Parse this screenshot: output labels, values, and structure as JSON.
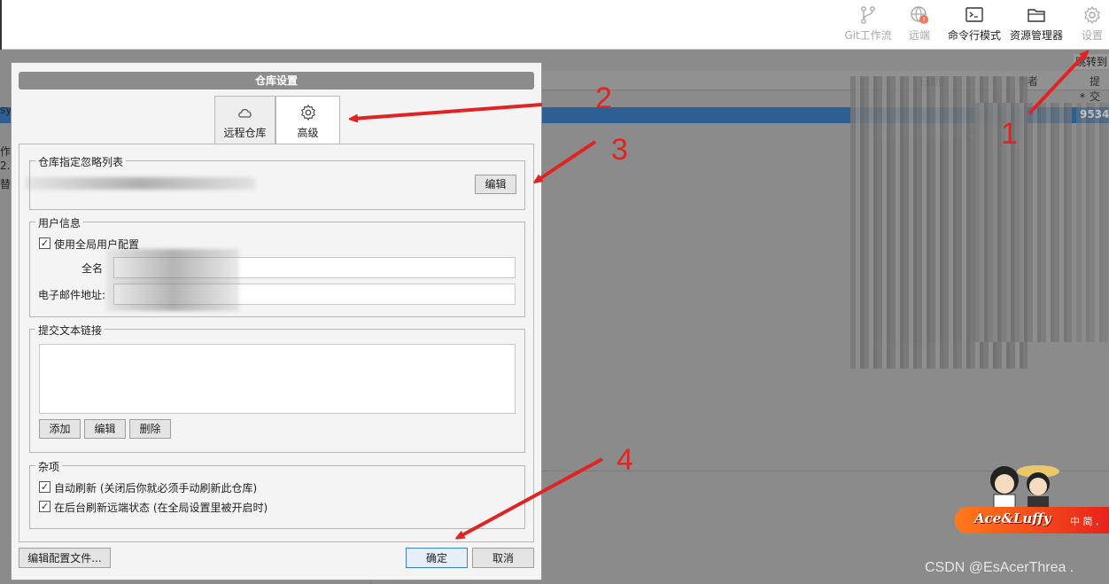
{
  "toolbar": {
    "items": [
      {
        "label": "Git工作流",
        "icon": "git-flow-icon",
        "enabled": false
      },
      {
        "label": "远端",
        "icon": "remote-globe-icon",
        "enabled": false
      },
      {
        "label": "命令行模式",
        "icon": "terminal-icon",
        "enabled": true
      },
      {
        "label": "资源管理器",
        "icon": "folder-icon",
        "enabled": true
      },
      {
        "label": "设置",
        "icon": "gear-icon",
        "enabled": false
      }
    ]
  },
  "background": {
    "jump_label": "跳转到",
    "columns": [
      "日期",
      "作者",
      "提交"
    ],
    "star": "*",
    "hash": "9534",
    "left_cut": [
      "sy",
      "作",
      "2.",
      "替换"
    ]
  },
  "dialog": {
    "title": "仓库设置",
    "tabs": [
      {
        "label": "远程仓库",
        "icon": "cloud-icon",
        "active": false
      },
      {
        "label": "高级",
        "icon": "gear-icon",
        "active": true
      }
    ],
    "ignore_group": {
      "title": "仓库指定忽略列表",
      "edit_button": "编辑"
    },
    "user_group": {
      "title": "用户信息",
      "use_global_label": "使用全局用户配置",
      "use_global_checked": true,
      "fullname_label": "全名",
      "email_label": "电子邮件地址:"
    },
    "links_group": {
      "title": "提交文本链接",
      "add_button": "添加",
      "edit_button": "编辑",
      "delete_button": "删除"
    },
    "misc_group": {
      "title": "杂项",
      "auto_refresh_label": "自动刷新 (关闭后你就必须手动刷新此仓库)",
      "auto_refresh_checked": true,
      "bg_refresh_label": "在后台刷新远端状态 (在全局设置里被开启时)",
      "bg_refresh_checked": true
    },
    "edit_config_button": "编辑配置文件...",
    "ok_button": "确定",
    "cancel_button": "取消"
  },
  "annotations": [
    "1",
    "2",
    "3",
    "4"
  ],
  "annotation_color": "#e02424",
  "badge": {
    "text": "Ace&Luffy",
    "suffix": "中 简 ,"
  },
  "watermark": "CSDN @EsAcerThrea ."
}
